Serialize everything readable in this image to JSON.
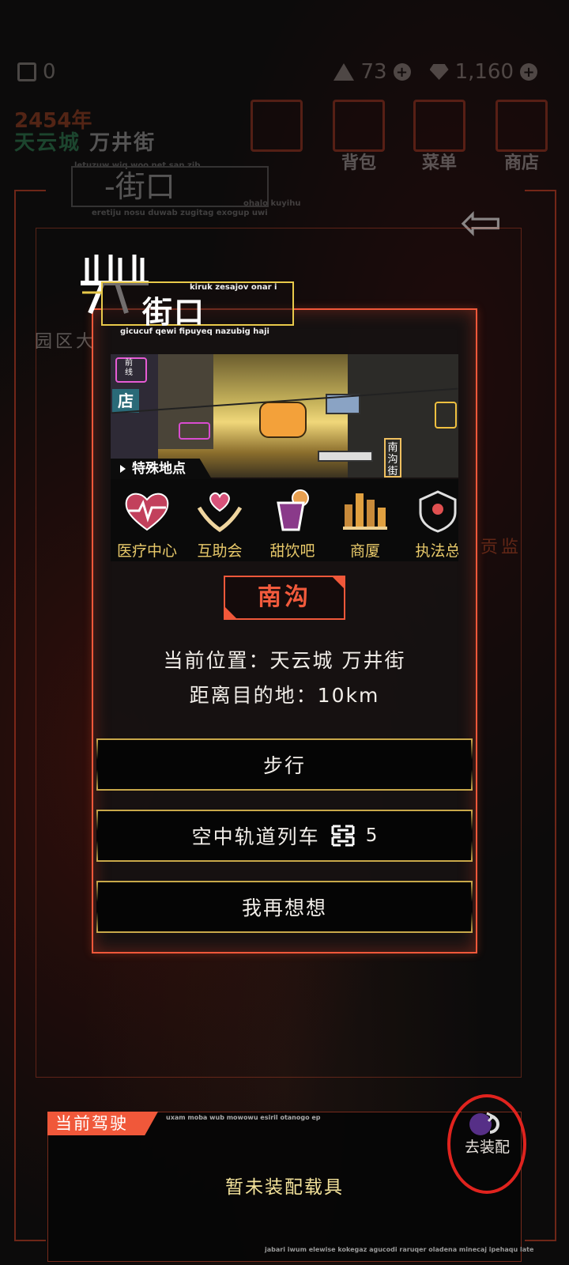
{
  "hud": {
    "currency_left": "0",
    "energy": "73",
    "gems": "1,160",
    "year": "2454年",
    "city": "天云城",
    "street": "万井街",
    "menu": [
      {
        "icon": "layers-icon",
        "label": ""
      },
      {
        "icon": "backpack-icon",
        "label": "背包"
      },
      {
        "icon": "menu-list-icon",
        "label": "菜单"
      },
      {
        "icon": "cart-icon",
        "label": "商店"
      }
    ],
    "location_title": "-街口",
    "location_sub_top": "letuzuw wiq woo net san zib",
    "location_sub_bottom": "eretiju nosu duwab zugitag exogup uwi",
    "location_sub_right": "ohalo kuyihu",
    "bg_left_label": "园区大",
    "bg_right_label": "贡监",
    "bg_center_label": "南沟"
  },
  "dialog": {
    "title": "街口",
    "subtitle_top": "kiruk zesajov onar i",
    "subtitle_bottom": "gicucuf qewi fipuyeq nazubig haji",
    "special_label": "特殊地点",
    "scene_sign_a": "前线",
    "scene_sign_b": "店",
    "scene_sign_c": "南沟街",
    "pois": [
      {
        "icon": "heart-pulse-icon",
        "label": "医疗中心"
      },
      {
        "icon": "heart-hands-icon",
        "label": "互助会"
      },
      {
        "icon": "drink-icon",
        "label": "甜饮吧"
      },
      {
        "icon": "skyline-icon",
        "label": "商厦"
      },
      {
        "icon": "police-icon",
        "label": "执法总"
      }
    ],
    "destination": "南沟",
    "current_location": "当前位置：天云城 万井街",
    "distance": "距离目的地：10km",
    "options": {
      "walk": "步行",
      "train": "空中轨道列车",
      "train_cost": "5",
      "cancel": "我再想想"
    }
  },
  "drive": {
    "tag": "当前驾驶",
    "sub": "uxam moba wub mowowu esiril otanogo ep",
    "empty": "暂未装配载具",
    "equip_label": "去装配",
    "footer": "jabari iwum elewise kokegaz agucodi raruqer oladena minecaj ipehaqu late"
  },
  "colors": {
    "accent": "#f0583a",
    "gold": "#c8a84a",
    "poi_label": "#e8c96a",
    "annotation": "#e0231e"
  }
}
